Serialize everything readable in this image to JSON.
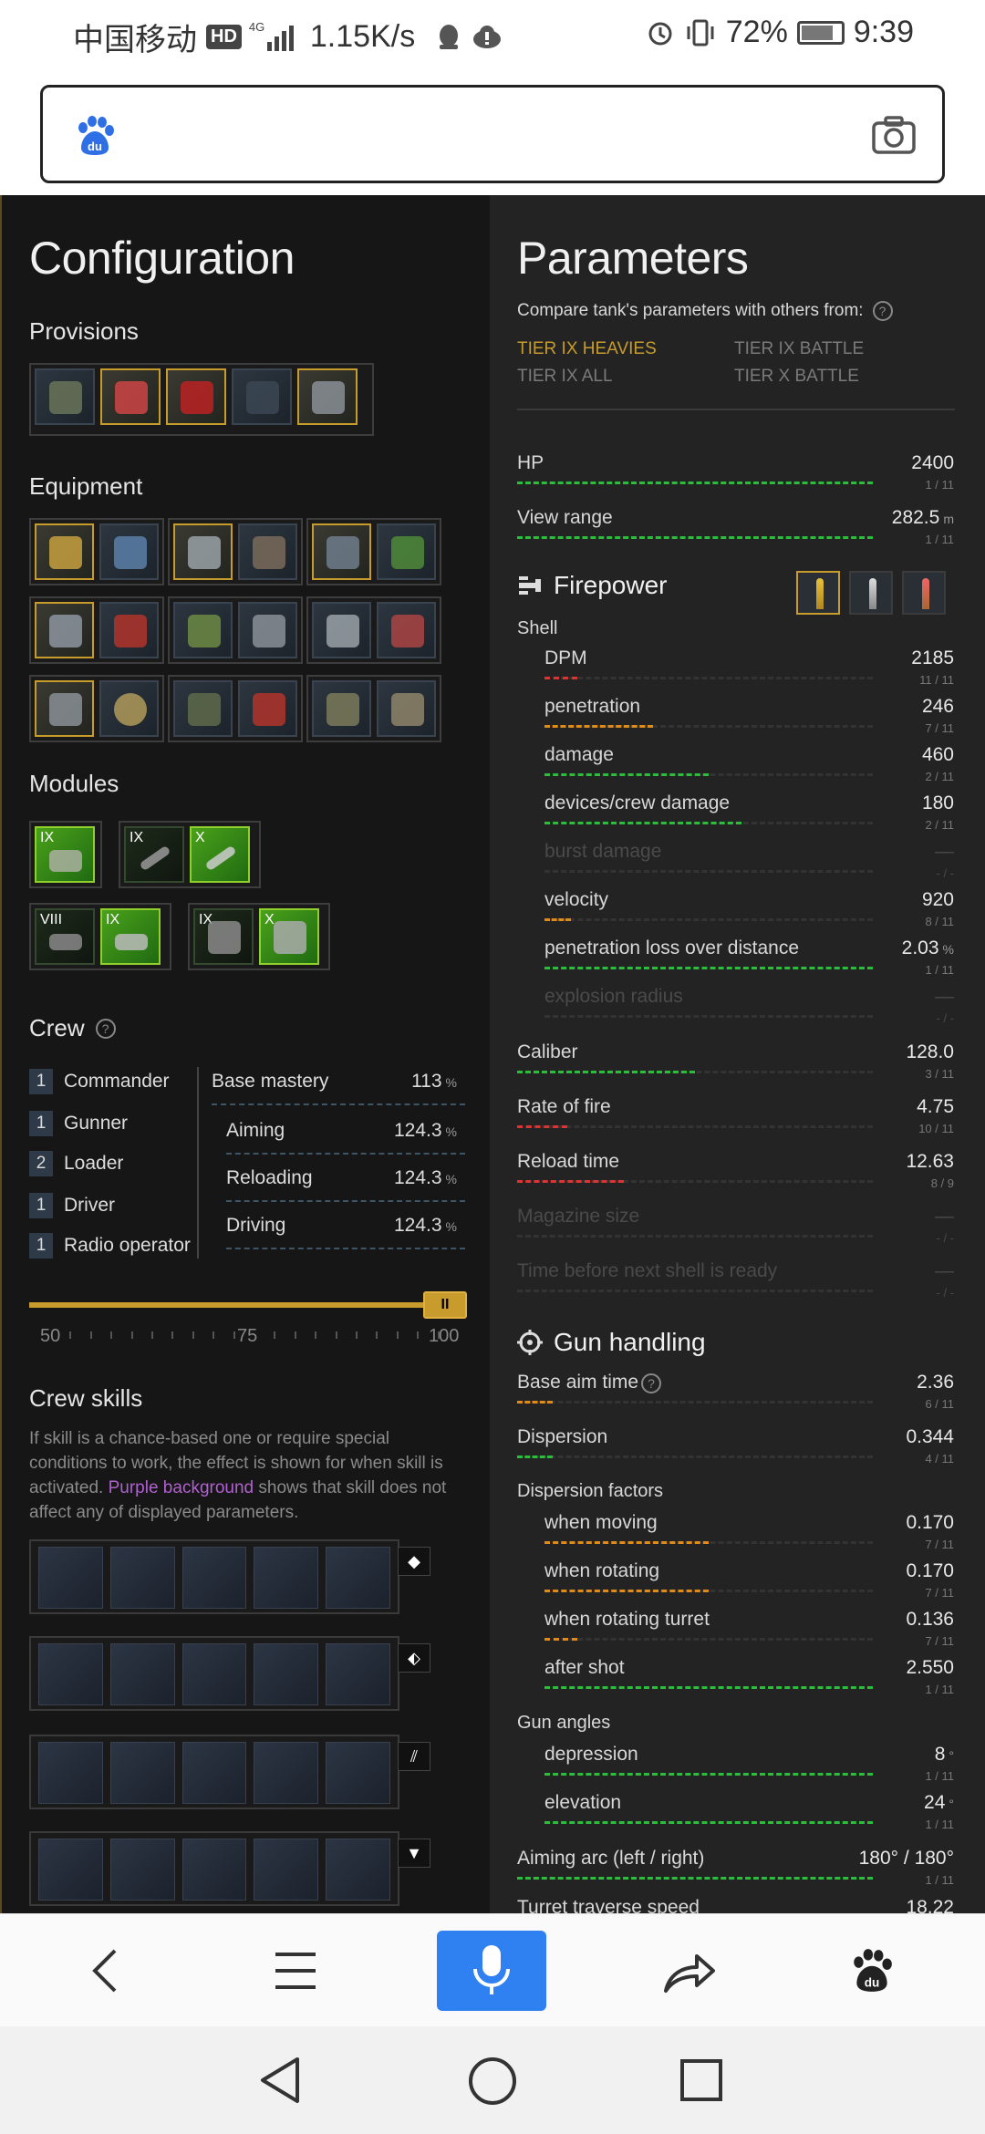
{
  "status_bar": {
    "carrier": "中国移动",
    "hd": "HD",
    "network": "4G",
    "speed": "1.15K/s",
    "battery": "72%",
    "time": "9:39"
  },
  "search": {
    "logo": "baidu-paw-icon",
    "camera": "camera-icon"
  },
  "left": {
    "title": "Configuration",
    "provisions": {
      "label": "Provisions",
      "slots": 5
    },
    "equipment": {
      "label": "Equipment"
    },
    "modules": {
      "label": "Modules",
      "tiers": [
        "IX",
        "IX",
        "X",
        "VIII",
        "IX",
        "IX",
        "X"
      ]
    },
    "crew": {
      "label": "Crew",
      "members": [
        {
          "count": "1",
          "role": "Commander"
        },
        {
          "count": "1",
          "role": "Gunner"
        },
        {
          "count": "2",
          "role": "Loader"
        },
        {
          "count": "1",
          "role": "Driver"
        },
        {
          "count": "1",
          "role": "Radio operator"
        }
      ],
      "base_mastery_label": "Base mastery",
      "base_mastery_value": "113",
      "stats": [
        {
          "label": "Aiming",
          "value": "124.3"
        },
        {
          "label": "Reloading",
          "value": "124.3"
        },
        {
          "label": "Driving",
          "value": "124.3"
        }
      ],
      "pct": "%",
      "slider_value": 100,
      "slider_thumb": "II",
      "slider_labels": [
        "50",
        "75",
        "100"
      ]
    },
    "crew_skills": {
      "label": "Crew skills",
      "note_before": "If skill is a chance-based one or require special conditions to work, the effect is shown for when skill is activated.",
      "note_purple": "Purple background",
      "note_after": "shows that skill does not affect any of displayed parameters.",
      "row_buttons": [
        "◆",
        "⬖",
        "⫽",
        "▼"
      ]
    }
  },
  "right": {
    "title": "Parameters",
    "compare_label": "Compare tank's parameters with others from:",
    "compare_options": [
      {
        "label": "TIER IX HEAVIES",
        "active": true
      },
      {
        "label": "TIER IX BATTLE",
        "active": false
      },
      {
        "label": "TIER IX ALL",
        "active": false
      },
      {
        "label": "TIER X BATTLE",
        "active": false
      }
    ],
    "hp": {
      "label": "HP",
      "value": "2400",
      "rank": "1 / 11",
      "fill": 1.0,
      "color": "green"
    },
    "view_range": {
      "label": "View range",
      "value": "282.5",
      "unit": "m",
      "rank": "1 / 11",
      "fill": 1.0,
      "color": "green"
    },
    "firepower": {
      "title": "Firepower",
      "shell_label": "Shell",
      "rows": [
        {
          "label": "DPM",
          "value": "2185",
          "rank": "11 / 11",
          "fill": 0.1,
          "color": "red"
        },
        {
          "label": "penetration",
          "value": "246",
          "rank": "7 / 11",
          "fill": 0.33,
          "color": "orange"
        },
        {
          "label": "damage",
          "value": "460",
          "rank": "2 / 11",
          "fill": 0.5,
          "color": "green"
        },
        {
          "label": "devices/crew damage",
          "value": "180",
          "rank": "2 / 11",
          "fill": 0.6,
          "color": "green"
        },
        {
          "label": "burst damage",
          "value": "—",
          "rank": "- / -",
          "fill": 0,
          "color": "dim"
        },
        {
          "label": "velocity",
          "value": "920",
          "rank": "8 / 11",
          "fill": 0.08,
          "color": "orange"
        },
        {
          "label": "penetration loss over distance",
          "value": "2.03",
          "unit": "%",
          "rank": "1 / 11",
          "fill": 1.0,
          "color": "green"
        },
        {
          "label": "explosion radius",
          "value": "—",
          "rank": "- / -",
          "fill": 0,
          "color": "dim"
        }
      ],
      "caliber": {
        "label": "Caliber",
        "value": "128.0",
        "rank": "3 / 11",
        "fill": 0.5,
        "color": "green"
      },
      "rof": {
        "label": "Rate of fire",
        "value": "4.75",
        "rank": "10 / 11",
        "fill": 0.14,
        "color": "red"
      },
      "reload": {
        "label": "Reload time",
        "value": "12.63",
        "rank": "8 / 9",
        "fill": 0.3,
        "color": "red"
      },
      "magazine": {
        "label": "Magazine size",
        "value": "—",
        "rank": "- / -"
      },
      "next_shell": {
        "label": "Time before next shell is ready",
        "value": "—",
        "rank": "- / -"
      }
    },
    "gun_handling": {
      "title": "Gun handling",
      "aim_time": {
        "label": "Base aim time",
        "value": "2.36",
        "rank": "6 / 11",
        "fill": 0.1,
        "color": "orange"
      },
      "dispersion": {
        "label": "Dispersion",
        "value": "0.344",
        "rank": "4 / 11",
        "fill": 0.1,
        "color": "green"
      },
      "factors_label": "Dispersion factors",
      "factors": [
        {
          "label": "when moving",
          "value": "0.170",
          "rank": "7 / 11",
          "fill": 0.5,
          "color": "orange"
        },
        {
          "label": "when rotating",
          "value": "0.170",
          "rank": "7 / 11",
          "fill": 0.5,
          "color": "orange"
        },
        {
          "label": "when rotating turret",
          "value": "0.136",
          "rank": "7 / 11",
          "fill": 0.1,
          "color": "orange"
        },
        {
          "label": "after shot",
          "value": "2.550",
          "rank": "1 / 11",
          "fill": 1.0,
          "color": "green"
        }
      ],
      "angles_label": "Gun angles",
      "angles": [
        {
          "label": "depression",
          "value": "8",
          "unit": "°",
          "rank": "1 / 11",
          "fill": 1.0,
          "color": "green"
        },
        {
          "label": "elevation",
          "value": "24",
          "unit": "°",
          "rank": "1 / 11",
          "fill": 1.0,
          "color": "green"
        }
      ],
      "aiming_arc": {
        "label": "Aiming arc (left / right)",
        "value_l": "180",
        "value_r": "180",
        "unit": "°",
        "rank": "1 / 11"
      },
      "turret_traverse": {
        "label": "Turret traverse speed",
        "value": "18.22"
      }
    }
  },
  "nav": {
    "back": "back-icon",
    "menu": "menu-icon",
    "voice": "microphone-icon",
    "share": "share-icon",
    "home": "baidu-paw-icon"
  },
  "colors": {
    "gold": "#c79b2c",
    "green": "#2bbd3c",
    "orange": "#e08a18",
    "red": "#dd3333",
    "purple": "#b060d0",
    "blue": "#2f80f0"
  }
}
